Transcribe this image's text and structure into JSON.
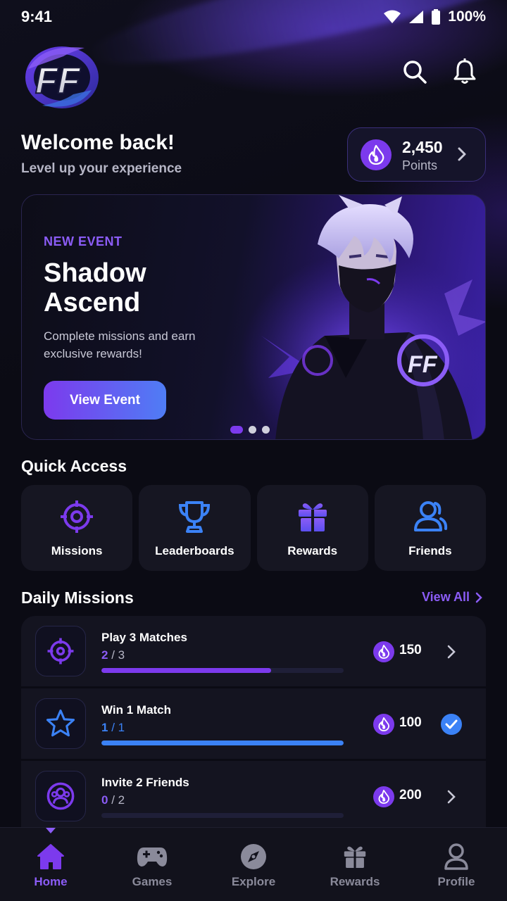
{
  "status_bar": {
    "time": "9:41",
    "battery": "100%"
  },
  "header": {
    "logo_text": "FF",
    "icons": [
      "search-icon",
      "bell-icon"
    ]
  },
  "welcome": {
    "title": "Welcome back!",
    "subtitle": "Level up your experience"
  },
  "points": {
    "value": "2,450",
    "label": "Points",
    "icon": "flame-icon"
  },
  "event": {
    "tag": "NEW EVENT",
    "title": "Shadow Ascend",
    "description": "Complete missions and earn exclusive rewards!",
    "button": "View Event",
    "slides": 3,
    "active_slide": 1
  },
  "quick_access": {
    "title": "Quick Access",
    "items": [
      {
        "label": "Missions",
        "icon": "target-icon"
      },
      {
        "label": "Leaderboards",
        "icon": "trophy-icon"
      },
      {
        "label": "Rewards",
        "icon": "gift-icon"
      },
      {
        "label": "Friends",
        "icon": "friends-icon"
      }
    ]
  },
  "daily_missions": {
    "title": "Daily Missions",
    "view_all": "View All",
    "items": [
      {
        "name": "Play 3 Matches",
        "current": "2",
        "total": "/ 3",
        "progress": 0.7,
        "reward": "150",
        "icon": "target-icon",
        "status": "chevron",
        "color": "#7c3aed"
      },
      {
        "name": "Win 1 Match",
        "current": "1",
        "total": "/ 1",
        "progress": 1.0,
        "reward": "100",
        "icon": "star-icon",
        "status": "completed",
        "color": "#3b82f6"
      },
      {
        "name": "Invite 2 Friends",
        "current": "0",
        "total": "/ 2",
        "progress": 0.0,
        "reward": "200",
        "icon": "friends-icon",
        "status": "chevron",
        "color": "#7c3aed"
      }
    ]
  },
  "bottom_nav": {
    "items": [
      {
        "label": "Home",
        "icon": "home-icon",
        "active": true
      },
      {
        "label": "Games",
        "icon": "gamepad-icon",
        "active": false
      },
      {
        "label": "Explore",
        "icon": "compass-icon",
        "active": false
      },
      {
        "label": "Rewards",
        "icon": "gift-icon",
        "active": false
      },
      {
        "label": "Profile",
        "icon": "profile-icon",
        "active": false
      }
    ]
  },
  "colors": {
    "accent": "#7c3aed",
    "accent_light": "#8b5cf6",
    "blue": "#3b82f6",
    "background": "#0b0b14",
    "card": "#161622"
  }
}
